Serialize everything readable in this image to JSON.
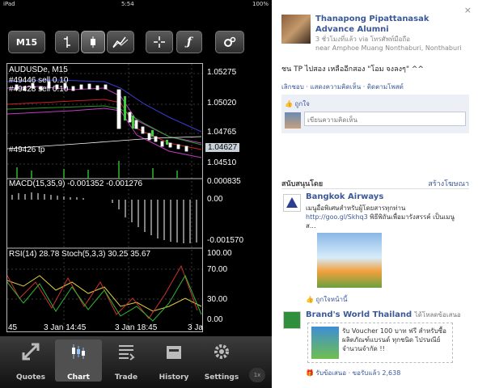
{
  "status": {
    "carrier": "iPad",
    "time": "5:54",
    "battery": "100%"
  },
  "toolbar": {
    "timeframe": "M15"
  },
  "chart": {
    "symbol_label": "AUDUSDe, M15",
    "overlay_lines": [
      "#49446 sell 0.10",
      "#49428 sell 0.10"
    ],
    "tp_label": "#49426 tp",
    "price_axis": [
      "1.05275",
      "1.05020",
      "1.04765",
      "1.04627",
      "1.04510"
    ],
    "current_price": "1.04627",
    "macd_label": "MACD(15,35,9) -0.001352 -0.001276",
    "macd_axis": [
      "0.000835",
      "0.00",
      "-0.001570"
    ],
    "rsi_label": "RSI(14) 28.78 Stoch(5,3,3) 30.25 35.67",
    "rsi_axis": [
      "100.00",
      "70.00",
      "30.00",
      "0.00"
    ],
    "time_axis": [
      "45",
      "3 Jan 14:45",
      "3 Jan 18:45",
      "3 Ja"
    ]
  },
  "tabs": [
    {
      "label": "Quotes",
      "icon": "quotes-icon"
    },
    {
      "label": "Chart",
      "icon": "chart-icon"
    },
    {
      "label": "Trade",
      "icon": "trade-icon"
    },
    {
      "label": "History",
      "icon": "history-icon"
    },
    {
      "label": "Settings",
      "icon": "settings-icon"
    }
  ],
  "corner_badge": "1x",
  "facebook": {
    "close": "×",
    "post": {
      "author": "Thanapong Pipattanasak",
      "group": "Advance Alumni",
      "meta_time": "3 ชั่วโมงที่แล้ว via โทรศัพท์มือถือ",
      "meta_place": "near Amphoe Muang Nonthaburi, Nonthaburi",
      "message": "ชน TP ไปสอง เหลืออีกสอง \"โอม จงลงๆ\" ^^",
      "actions": "เลิกชอบ · แสดงความคิดเห็น · ติดตามโพสต์",
      "like": "ถูกใจ",
      "comment_placeholder": "เขียนความคิดเห็น"
    },
    "sponsored": {
      "title": "สนับสนุนโดย",
      "create": "สร้างโฆษณา"
    },
    "ads": [
      {
        "title": "Bangkok Airways",
        "text": "เมนูอื่อพิเศษสำหรับผู้โดยสารทุกท่าน",
        "link": "http://goo.gl/Skhq3",
        "text2": "พิธีพิถันเพื่อมารังสรรค์ เป็นเมนูส...",
        "like": "ถูกใจหน้านี้"
      },
      {
        "title": "Brand's World Thailand",
        "subtitle": "ได้โหลดข้อเสนอ",
        "text": "รับ Voucher 100 บาท ฟรี สำหรับซื้อผลิตภัณฑ์แบรนด์ ทุกชนิด ไปรษณีย์ จำนวนจำกัด !!",
        "like": "รับข้อเสนอ · ขอรับแล้ว 2,638"
      }
    ]
  }
}
